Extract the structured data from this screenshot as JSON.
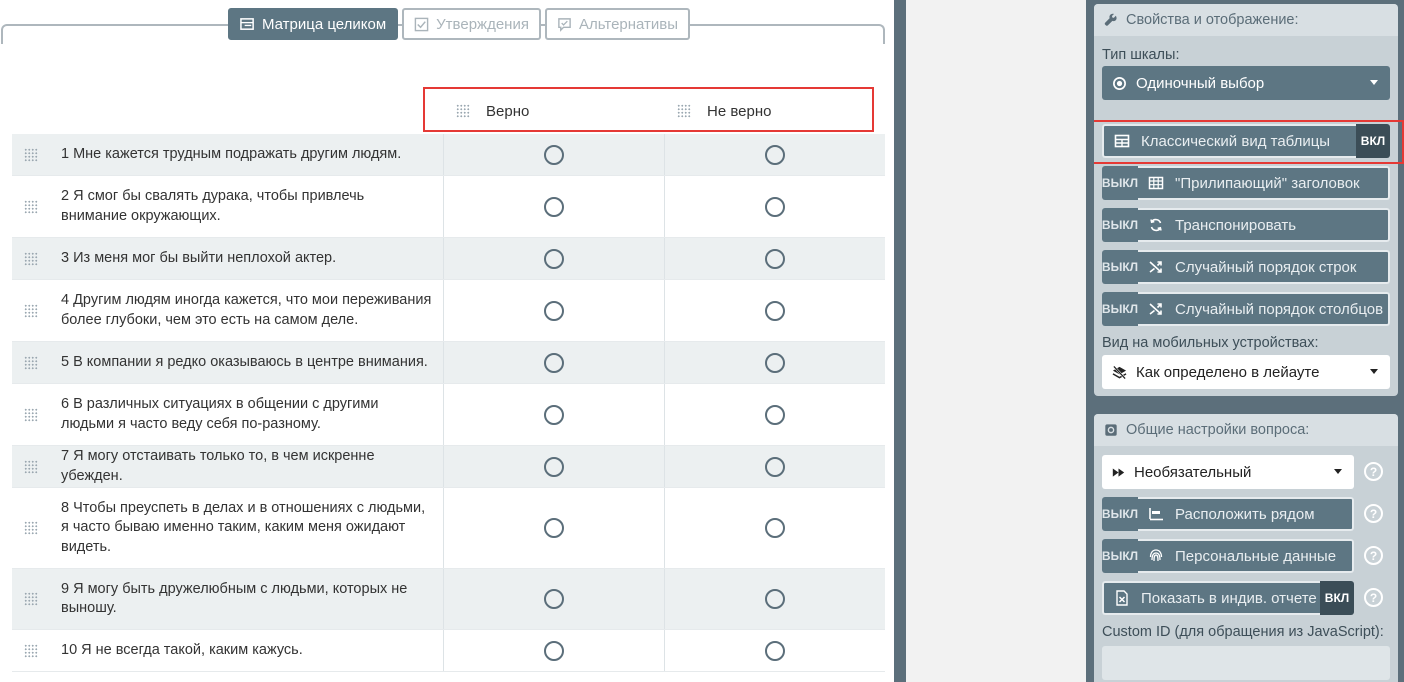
{
  "tabs": [
    {
      "label": "Матрица целиком",
      "icon": "matrix-icon",
      "active": true
    },
    {
      "label": "Утверждения",
      "icon": "checkbox-icon",
      "active": false
    },
    {
      "label": "Альтернативы",
      "icon": "comment-icon",
      "active": false
    }
  ],
  "columns": [
    "Верно",
    "Не верно"
  ],
  "rows": [
    "1 Мне кажется трудным подражать другим людям.",
    "2 Я смог бы свалять дурака, чтобы привлечь внимание окружающих.",
    "3 Из меня мог бы выйти неплохой актер.",
    "4 Другим людям иногда кажется, что мои переживания более глубоки, чем это есть на самом деле.",
    "5 В компании я редко оказываюсь в центре внимания.",
    "6 В различных ситуациях в общении с другими людьми я часто веду себя по-разному.",
    "7 Я могу отстаивать только то, в чем искренне убежден.",
    "8 Чтобы преуспеть в делах и в отношениях с людьми, я часто бываю именно таким, каким меня ожидают видеть.",
    "9 Я могу быть дружелюбным с людьми, которых не выношу.",
    "10 Я не всегда такой, каким кажусь."
  ],
  "props": {
    "title": "Свойства и отображение:",
    "scale_label": "Тип шкалы:",
    "scale_value": "Одиночный выбор",
    "classic": "Классический вид таблицы",
    "sticky": "\"Прилипающий\" заголовок",
    "transpose": "Транспонировать",
    "random_rows": "Случайный порядок строк",
    "random_cols": "Случайный порядок столбцов",
    "mobile_label": "Вид на мобильных устройствах:",
    "mobile_value": "Как определено в лейауте",
    "on": "ВКЛ",
    "off": "ВЫКЛ"
  },
  "general": {
    "title": "Общие настройки вопроса:",
    "required_value": "Необязательный",
    "side_by_side": "Расположить рядом",
    "personal": "Персональные данные",
    "report": "Показать в индив. отчете",
    "custom_id": "Custom ID (для обращения из JavaScript):",
    "help": "?"
  },
  "colors": {
    "accent": "#5d7683",
    "panel": "#5c6f7b",
    "highlight": "#e53935"
  }
}
